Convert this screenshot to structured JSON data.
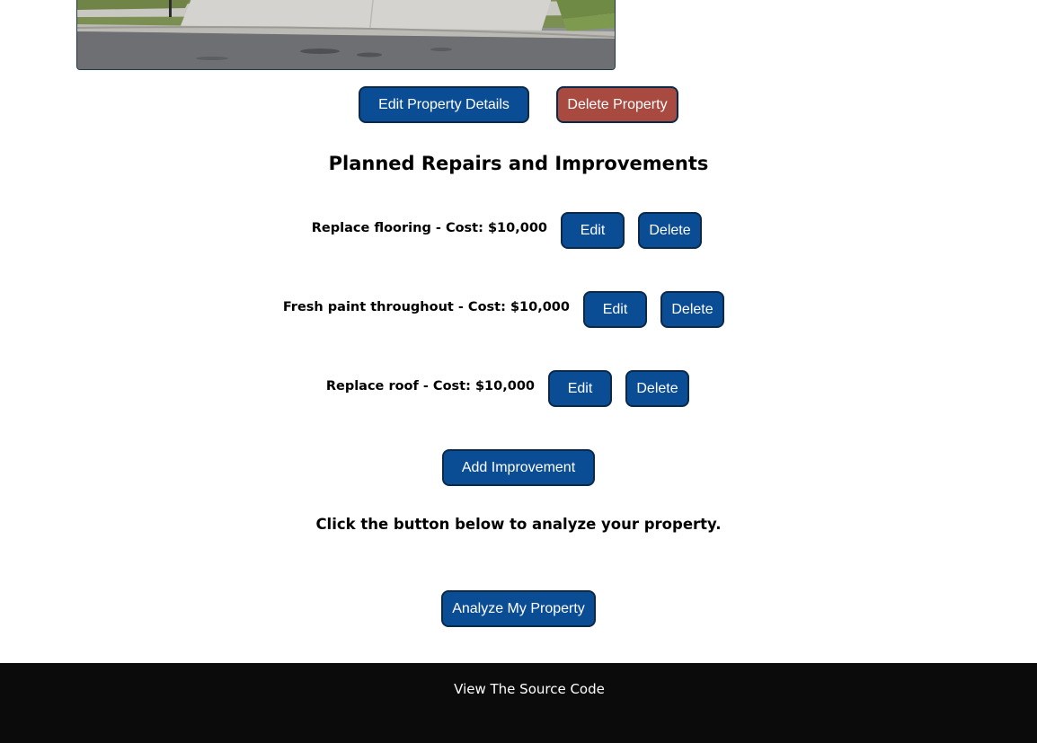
{
  "property": {
    "edit_label": "Edit Property Details",
    "delete_label": "Delete Property"
  },
  "repairs": {
    "heading": "Planned Repairs and Improvements",
    "items": [
      {
        "label": "Replace flooring - Cost: $10,000",
        "edit_label": "Edit",
        "delete_label": "Delete"
      },
      {
        "label": "Fresh paint throughout - Cost: $10,000",
        "edit_label": "Edit",
        "delete_label": "Delete"
      },
      {
        "label": "Replace roof - Cost: $10,000",
        "edit_label": "Edit",
        "delete_label": "Delete"
      }
    ],
    "add_label": "Add Improvement"
  },
  "analyze": {
    "prompt": "Click the button below to analyze your property.",
    "button_label": "Analyze My Property"
  },
  "footer": {
    "link_text": "View The Source Code"
  },
  "colors": {
    "primary_button": "#0b4d94",
    "danger_button": "#a84a40",
    "footer_bg": "#0b0b0b"
  }
}
